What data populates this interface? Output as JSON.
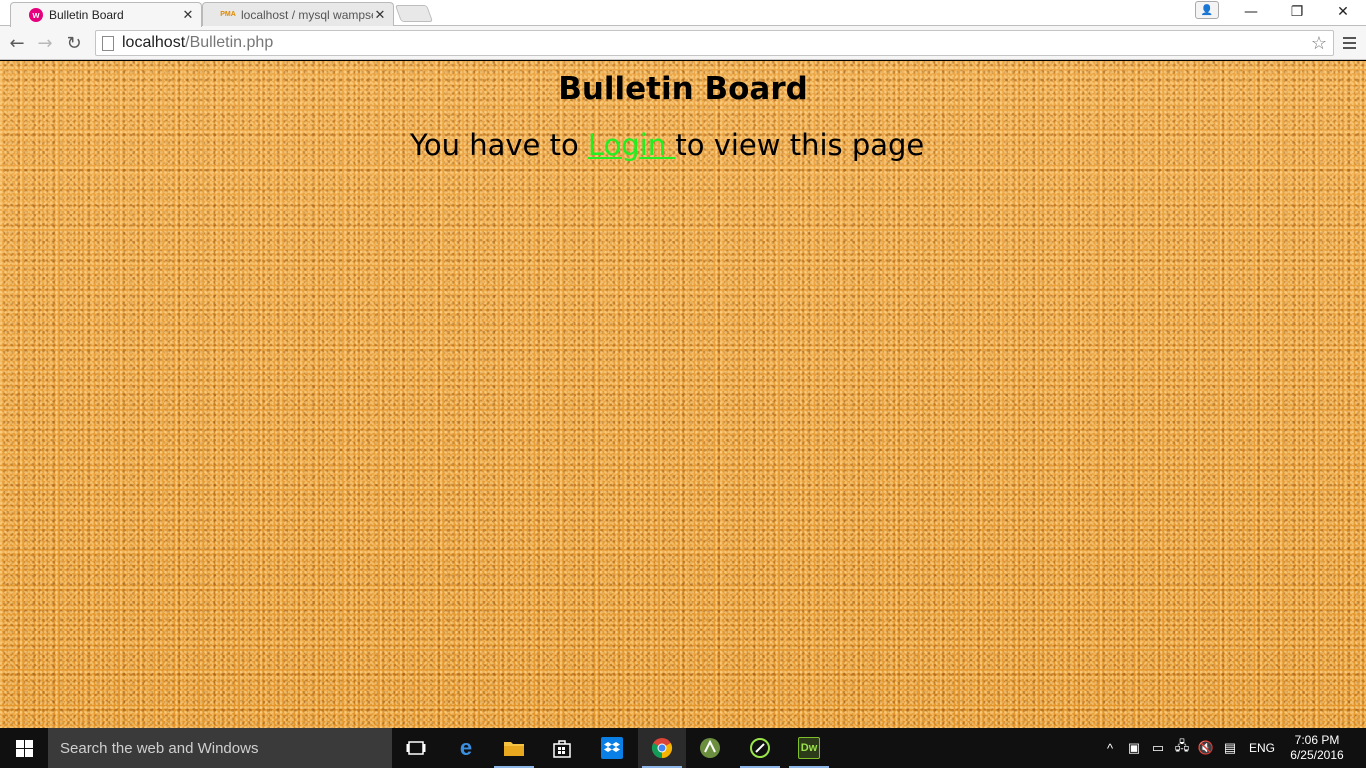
{
  "browser": {
    "tabs": [
      {
        "title": "Bulletin Board",
        "favicon": "wamp-icon",
        "active": true
      },
      {
        "title": "localhost / mysql wampse",
        "favicon": "pma-icon",
        "favicon_text": "PMA",
        "active": false
      }
    ],
    "address": {
      "host": "localhost",
      "path": "/Bulletin.php"
    },
    "window_controls": {
      "minimize": "—",
      "maximize": "❐",
      "close": "✕"
    }
  },
  "page": {
    "title": "Bulletin Board",
    "message_before": "You have to ",
    "login_link": "Login ",
    "message_after": "to view this page",
    "link_color": "#22ee22",
    "background_color": "#e69a2e"
  },
  "taskbar": {
    "search_placeholder": "Search the web and Windows",
    "apps": [
      "task-view",
      "edge",
      "file-explorer",
      "store",
      "dropbox",
      "chrome",
      "android-studio",
      "app-icon",
      "dreamweaver"
    ],
    "dreamweaver_label": "Dw",
    "tray": {
      "language": "ENG",
      "time": "7:06 PM",
      "date": "6/25/2016"
    }
  }
}
